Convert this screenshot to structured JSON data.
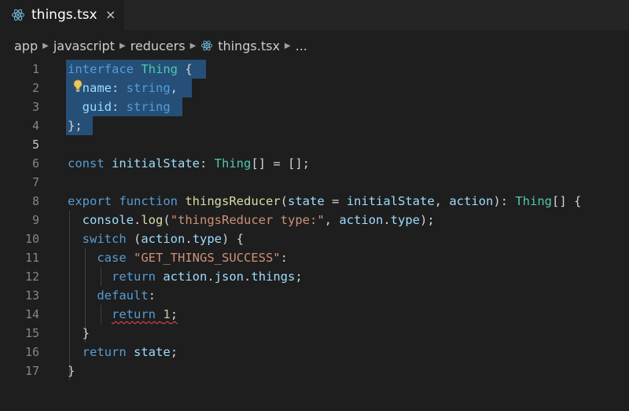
{
  "tab": {
    "title": "things.tsx",
    "close": "×"
  },
  "breadcrumb": {
    "items": [
      "app",
      "javascript",
      "reducers",
      "things.tsx",
      "..."
    ]
  },
  "editor": {
    "lines": [
      {
        "n": "1",
        "tokens": [
          [
            "kw",
            "interface"
          ],
          [
            "pl",
            " "
          ],
          [
            "ty",
            "Thing"
          ],
          [
            "pl",
            " {"
          ]
        ]
      },
      {
        "n": "2",
        "tokens": [
          [
            "pl",
            "  "
          ],
          [
            "id",
            "name"
          ],
          [
            "pl",
            ": "
          ],
          [
            "kw",
            "string"
          ],
          [
            "pl",
            ","
          ]
        ]
      },
      {
        "n": "3",
        "tokens": [
          [
            "pl",
            "  "
          ],
          [
            "id",
            "guid"
          ],
          [
            "pl",
            ": "
          ],
          [
            "kw",
            "string"
          ]
        ]
      },
      {
        "n": "4",
        "tokens": [
          [
            "pl",
            "};"
          ]
        ]
      },
      {
        "n": "5",
        "tokens": []
      },
      {
        "n": "6",
        "tokens": [
          [
            "kw",
            "const"
          ],
          [
            "pl",
            " "
          ],
          [
            "id",
            "initialState"
          ],
          [
            "pl",
            ": "
          ],
          [
            "ty",
            "Thing"
          ],
          [
            "pl",
            "[] = [];"
          ]
        ]
      },
      {
        "n": "7",
        "tokens": []
      },
      {
        "n": "8",
        "tokens": [
          [
            "kw",
            "export"
          ],
          [
            "pl",
            " "
          ],
          [
            "kw",
            "function"
          ],
          [
            "pl",
            " "
          ],
          [
            "fn",
            "thingsReducer"
          ],
          [
            "pl",
            "("
          ],
          [
            "id",
            "state"
          ],
          [
            "pl",
            " = "
          ],
          [
            "id",
            "initialState"
          ],
          [
            "pl",
            ", "
          ],
          [
            "id",
            "action"
          ],
          [
            "pl",
            "): "
          ],
          [
            "ty",
            "Thing"
          ],
          [
            "pl",
            "[] {"
          ]
        ]
      },
      {
        "n": "9",
        "tokens": [
          [
            "pl",
            "  "
          ],
          [
            "id",
            "console"
          ],
          [
            "pl",
            "."
          ],
          [
            "fn",
            "log"
          ],
          [
            "pl",
            "("
          ],
          [
            "str",
            "\"thingsReducer type:\""
          ],
          [
            "pl",
            ", "
          ],
          [
            "id",
            "action"
          ],
          [
            "pl",
            "."
          ],
          [
            "id",
            "type"
          ],
          [
            "pl",
            ");"
          ]
        ]
      },
      {
        "n": "10",
        "tokens": [
          [
            "pl",
            "  "
          ],
          [
            "kw",
            "switch"
          ],
          [
            "pl",
            " ("
          ],
          [
            "id",
            "action"
          ],
          [
            "pl",
            "."
          ],
          [
            "id",
            "type"
          ],
          [
            "pl",
            ") {"
          ]
        ]
      },
      {
        "n": "11",
        "tokens": [
          [
            "pl",
            "    "
          ],
          [
            "kw",
            "case"
          ],
          [
            "pl",
            " "
          ],
          [
            "str",
            "\"GET_THINGS_SUCCESS\""
          ],
          [
            "pl",
            ":"
          ]
        ]
      },
      {
        "n": "12",
        "tokens": [
          [
            "pl",
            "      "
          ],
          [
            "kw",
            "return"
          ],
          [
            "pl",
            " "
          ],
          [
            "id",
            "action"
          ],
          [
            "pl",
            "."
          ],
          [
            "id",
            "json"
          ],
          [
            "pl",
            "."
          ],
          [
            "id",
            "things"
          ],
          [
            "pl",
            ";"
          ]
        ]
      },
      {
        "n": "13",
        "tokens": [
          [
            "pl",
            "    "
          ],
          [
            "kw",
            "default"
          ],
          [
            "pl",
            ":"
          ]
        ]
      },
      {
        "n": "14",
        "tokens": [
          [
            "pl",
            "      "
          ],
          [
            "kw squig",
            "return"
          ],
          [
            "pl squig",
            " "
          ],
          [
            "num squig",
            "1"
          ],
          [
            "pl squig",
            ";"
          ]
        ]
      },
      {
        "n": "15",
        "tokens": [
          [
            "pl",
            "  }"
          ]
        ]
      },
      {
        "n": "16",
        "tokens": [
          [
            "pl",
            "  "
          ],
          [
            "kw",
            "return"
          ],
          [
            "pl",
            " "
          ],
          [
            "id",
            "state"
          ],
          [
            "pl",
            ";"
          ]
        ]
      },
      {
        "n": "17",
        "tokens": [
          [
            "pl",
            "}"
          ]
        ]
      }
    ]
  },
  "colors": {
    "background": "#1e1e1e",
    "selection": "#264f78",
    "keyword": "#569cd6",
    "type": "#4ec9b0",
    "identifier": "#9cdcfe",
    "function": "#dcdcaa",
    "string": "#ce9178",
    "error": "#f14c4c"
  }
}
